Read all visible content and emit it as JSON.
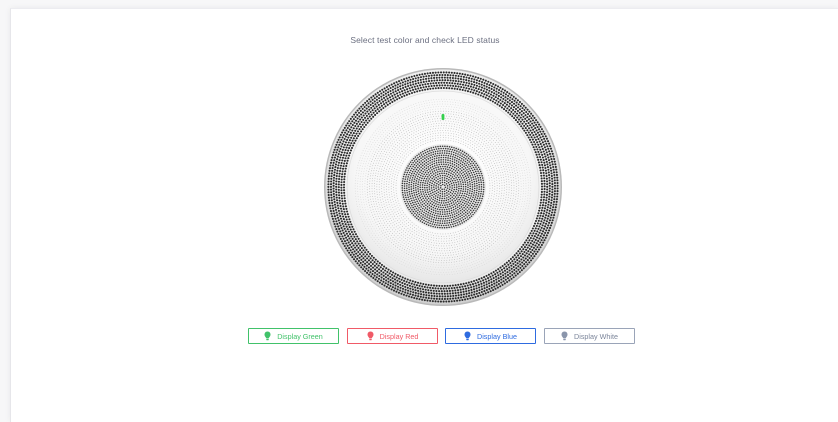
{
  "page": {
    "instruction": "Select test color and check LED status"
  },
  "device": {
    "led_color": "#34d04c"
  },
  "buttons": [
    {
      "label": "Display Green",
      "color": "#41c26a",
      "icon": "bulb-icon"
    },
    {
      "label": "Display Red",
      "color": "#f05a67",
      "icon": "bulb-icon"
    },
    {
      "label": "Display Blue",
      "color": "#2e6be0",
      "icon": "bulb-icon"
    },
    {
      "label": "Display White",
      "color": "#9aa4b8",
      "icon": "bulb-icon"
    }
  ]
}
